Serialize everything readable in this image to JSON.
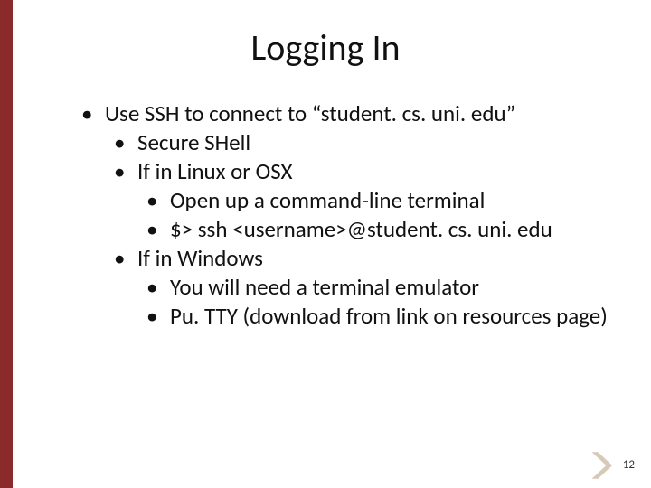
{
  "accent_color": "#8a2a2a",
  "title": "Logging In",
  "bullets": {
    "l1": "Use SSH to connect to “student. cs. uni. edu”",
    "l2a": "Secure SHell",
    "l2b": "If in Linux or OSX",
    "l3a": "Open up a command-line terminal",
    "l3b": "$> ssh <username>@student. cs. uni. edu",
    "l2c": "If in Windows",
    "l3c": "You will need a terminal emulator",
    "l3d": "Pu. TTY (download from link on resources page)"
  },
  "page_number": "12"
}
